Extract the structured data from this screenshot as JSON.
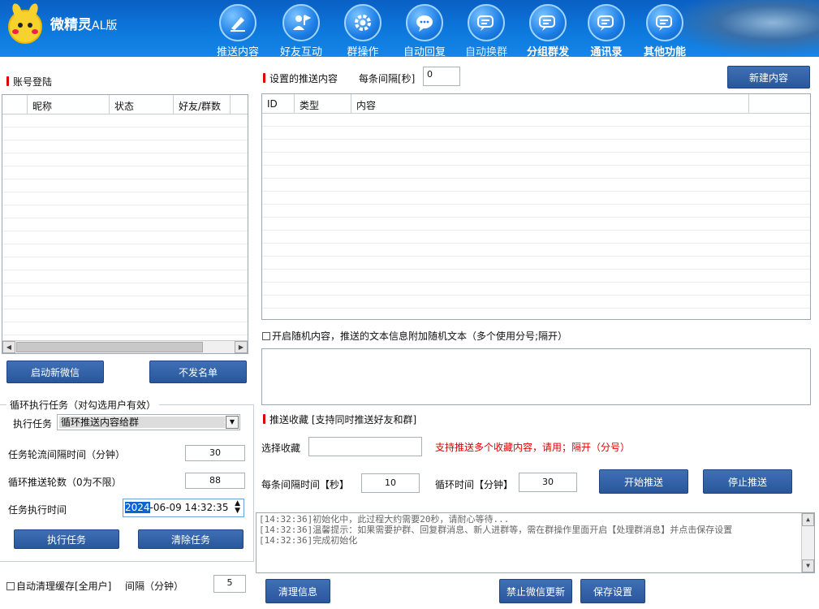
{
  "app": {
    "title": "微精灵",
    "edition": "AL版"
  },
  "nav": [
    {
      "label": "推送内容",
      "icon": "pen-icon"
    },
    {
      "label": "好友互动",
      "icon": "user-flag-icon"
    },
    {
      "label": "群操作",
      "icon": "gear-icon"
    },
    {
      "label": "自动回复",
      "icon": "chat-bubble-icon"
    },
    {
      "label": "自动换群",
      "icon": "chat-double-icon"
    },
    {
      "label": "分组群发",
      "icon": "chat-double-icon"
    },
    {
      "label": "通讯录",
      "icon": "chat-double-icon"
    },
    {
      "label": "其他功能",
      "icon": "chat-double-icon"
    }
  ],
  "accounts": {
    "title": "账号登陆",
    "columns": [
      "昵称",
      "状态",
      "好友/群数"
    ],
    "start_wechat": "启动新微信",
    "no_send_list": "不发名单"
  },
  "loop": {
    "legend": "循环执行任务（对勾选用户有效）",
    "task_label": "执行任务",
    "task_value": "循环推送内容给群",
    "interval_label": "任务轮流间隔时间（分钟）",
    "interval_value": "30",
    "rounds_label": "循环推送轮数（0为不限）",
    "rounds_value": "88",
    "time_label": "任务执行时间",
    "time_year": "2024",
    "time_rest": "-06-09 14:32:35",
    "execute": "执行任务",
    "clear": "清除任务"
  },
  "cache": {
    "label": "自动清理缓存[全用户]",
    "interval_label": "间隔（分钟）",
    "interval_value": "5"
  },
  "push": {
    "title": "设置的推送内容",
    "gap_label": "每条间隔[秒]",
    "gap_value": "0",
    "new_content": "新建内容",
    "columns": [
      "ID",
      "类型",
      "内容"
    ],
    "random_label": "开启随机内容，推送的文本信息附加随机文本（多个使用分号;隔开）"
  },
  "favorites": {
    "title": "推送收藏 [支持同时推送好友和群]",
    "select_label": "选择收藏",
    "select_value": "",
    "hint": "支持推送多个收藏内容，请用；隔开（分号）",
    "hint_color": "#e00000",
    "gap_label": "每条间隔时间【秒】",
    "gap_value": "10",
    "cycle_label": "循环时间【分钟】",
    "cycle_value": "30",
    "start": "开始推送",
    "stop": "停止推送"
  },
  "log": [
    "[14:32:36]初始化中，此过程大约需要20秒，请耐心等待...",
    "[14:32:36]温馨提示：如果需要护群、回复群消息、新人进群等，需在群操作里面开启【处理群消息】并点击保存设置",
    "[14:32:36]完成初始化"
  ],
  "footer": {
    "clear_info": "清理信息",
    "disable_update": "禁止微信更新",
    "save_settings": "保存设置"
  }
}
